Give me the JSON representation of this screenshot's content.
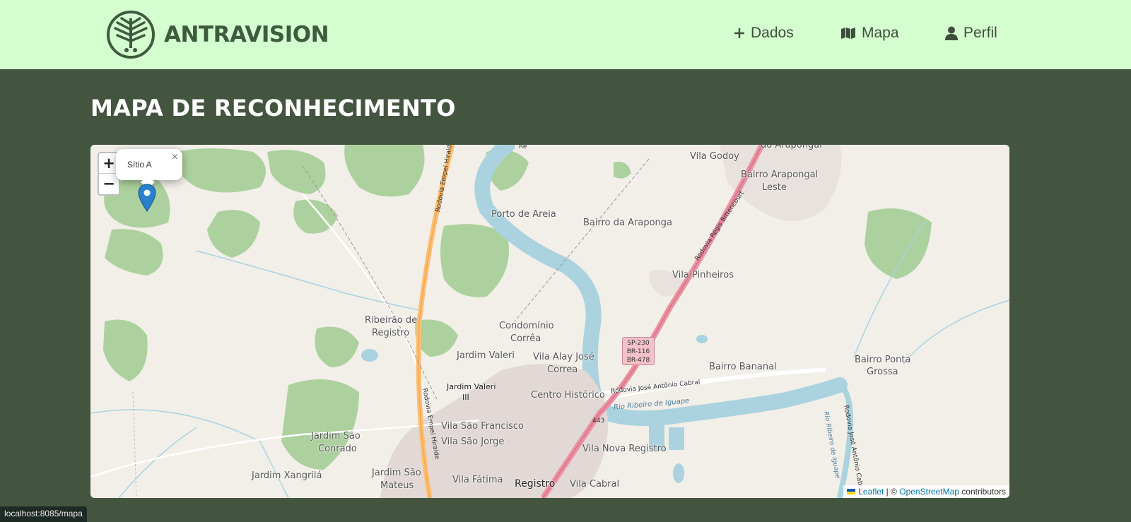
{
  "brand": {
    "name": "ANTRAVISION",
    "logo_icon": "leaf-circle-logo"
  },
  "nav": [
    {
      "label": "Dados",
      "icon": "plus-icon"
    },
    {
      "label": "Mapa",
      "icon": "map-icon"
    },
    {
      "label": "Perfil",
      "icon": "user-icon"
    }
  ],
  "page": {
    "title": "MAPA DE RECONHECIMENTO"
  },
  "map": {
    "zoom_in": "+",
    "zoom_out": "−",
    "popup": {
      "label": "Sítio A",
      "close": "×"
    },
    "places": [
      "Vila Godoy",
      "do Arapongal",
      "Bairro Arapongal",
      "Leste",
      "Porto de Areia",
      "Bairro da Araponga",
      "Vila Pinheiros",
      "Ribeirão de",
      "Registro",
      "Condomínio",
      "Corrêa",
      "Jardim Valeri",
      "Vila Alay José",
      "Correa",
      "Jardim Valeri",
      "III",
      "Centro Histórico",
      "Bairro Bananal",
      "Bairro Ponta",
      "Grossa",
      "Vila São Francisco",
      "Vila São Jorge",
      "Vila Nova Registro",
      "Jardim São",
      "Conrado",
      "Jardim Xangrilá",
      "Jardim São",
      "Mateus",
      "Vila Fátima",
      "Registro",
      "Vila Cabral"
    ],
    "roads": [
      "Rodovia Empei Hiraide",
      "Rodovia Régis Bittencourt",
      "Rodovia José Antônio Cabral",
      "Rio Ribeiro de Iguape",
      "Rodovia Empei Hiraide",
      "Rio Ribeiro de Iguape",
      "Rodovia José Antônio Cabral",
      "Re",
      "443"
    ],
    "shield": [
      "SP-230",
      "BR-116",
      "BR-478"
    ],
    "attribution": {
      "leaflet": "Leaflet",
      "separator": " | © ",
      "osm": "OpenStreetMap",
      "suffix": " contributors"
    }
  },
  "status_bar": {
    "url": "localhost:8085/mapa"
  },
  "colors": {
    "navbar_bg": "#d4fdd0",
    "page_bg": "#44553f",
    "brand_text": "#3f5b3e",
    "marker": "#2a81cb"
  }
}
